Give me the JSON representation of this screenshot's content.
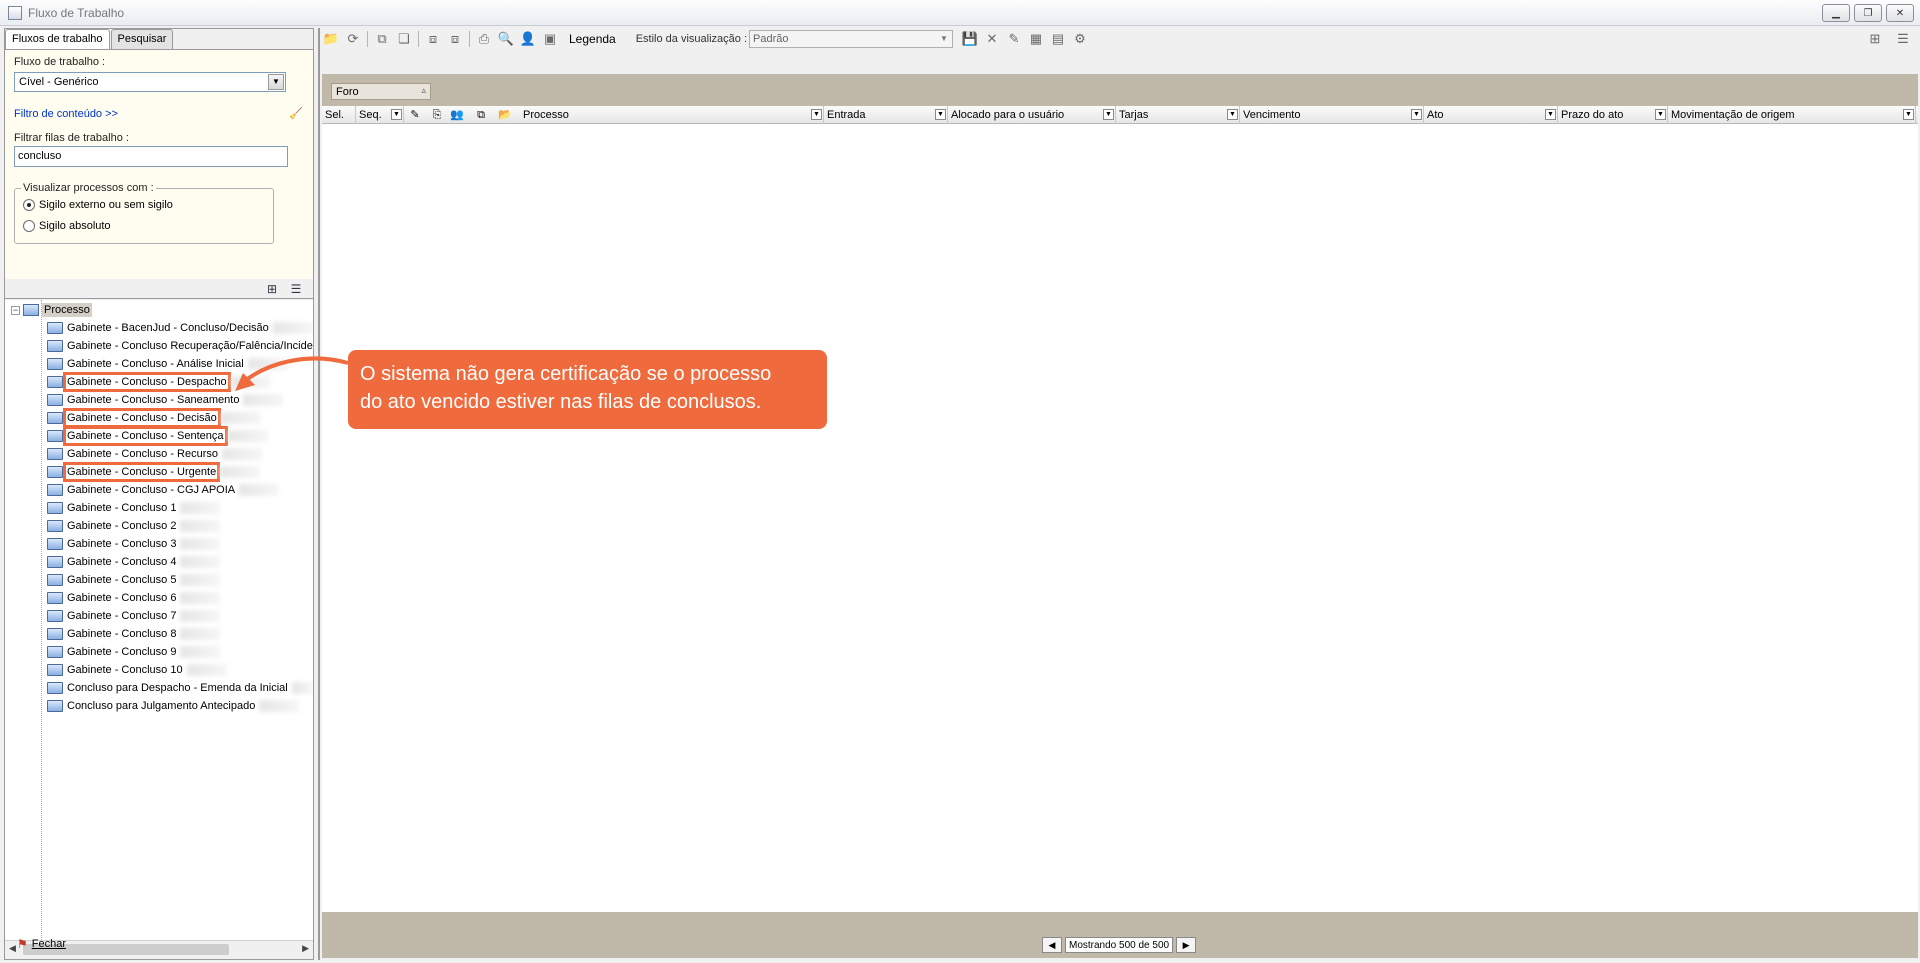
{
  "window": {
    "title": "Fluxo de Trabalho"
  },
  "left": {
    "tabs": [
      {
        "label": "Fluxos de trabalho"
      },
      {
        "label": "Pesquisar"
      }
    ],
    "fluxo_label": "Fluxo de trabalho :",
    "fluxo_value": "Cível - Genérico",
    "filtro_link": "Filtro de conteúdo >>",
    "filtrar_label": "Filtrar filas de trabalho :",
    "filtrar_value": "concluso",
    "visualizar_legend": "Visualizar processos com :",
    "radio_sigilo_externo": "Sigilo externo ou sem sigilo",
    "radio_sigilo_absoluto": "Sigilo absoluto",
    "tree_root": "Processo",
    "tree_items": [
      "Gabinete - BacenJud - Concluso/Decisão",
      "Gabinete - Concluso Recuperação/Falência/Incide",
      "Gabinete - Concluso - Análise Inicial",
      "Gabinete - Concluso - Despacho",
      "Gabinete - Concluso - Saneamento",
      "Gabinete - Concluso - Decisão",
      "Gabinete - Concluso - Sentença",
      "Gabinete - Concluso - Recurso",
      "Gabinete - Concluso - Urgente",
      "Gabinete - Concluso - CGJ APOIA",
      "Gabinete - Concluso 1",
      "Gabinete - Concluso 2",
      "Gabinete - Concluso 3",
      "Gabinete - Concluso 4",
      "Gabinete - Concluso 5",
      "Gabinete - Concluso 6",
      "Gabinete - Concluso 7",
      "Gabinete - Concluso 8",
      "Gabinete - Concluso 9",
      "Gabinete - Concluso 10",
      "Concluso para Despacho - Emenda da Inicial",
      "Concluso para Julgamento Antecipado"
    ],
    "fechar_label": "Fechar"
  },
  "toolbar": {
    "legenda_label": "Legenda",
    "estilo_label": "Estilo da visualização :",
    "estilo_value": "Padrão"
  },
  "grid": {
    "group_chip": "Foro",
    "columns": {
      "sel": "Sel.",
      "seq": "Seq.",
      "processo": "Processo",
      "entrada": "Entrada",
      "alocado": "Alocado para o usuário",
      "tarjas": "Tarjas",
      "vencimento": "Vencimento",
      "ato": "Ato",
      "prazo": "Prazo do ato",
      "movimentacao": "Movimentação de origem"
    },
    "pager_text": "Mostrando 500 de 500"
  },
  "callout": {
    "line1": "O sistema não gera certificação se o processo",
    "line2": "do ato vencido estiver nas filas de conclusos."
  },
  "colors": {
    "callout": "#ef6a3d",
    "group_bar": "#c0b8a8",
    "link": "#0033cc"
  }
}
